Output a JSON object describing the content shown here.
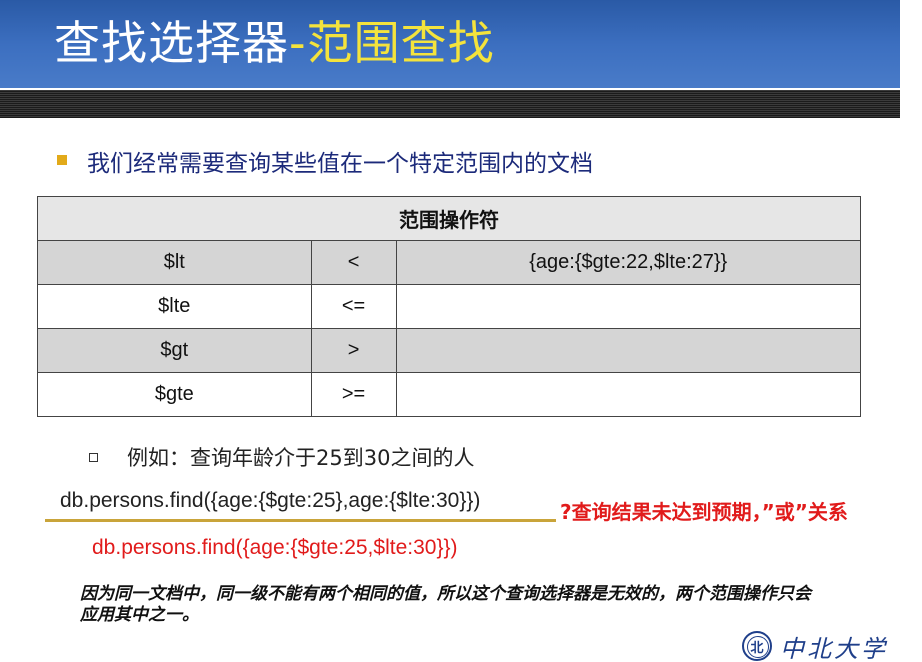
{
  "title": {
    "main": "查找选择器",
    "accent": "-范围查找"
  },
  "bullet_text": "我们经常需要查询某些值在一个特定范围内的文档",
  "table": {
    "header": "范围操作符",
    "rows": [
      {
        "op": "$lt",
        "sym": "<",
        "example": "{age:{$gte:22,$lte:27}}"
      },
      {
        "op": "$lte",
        "sym": "<=",
        "example": ""
      },
      {
        "op": "$gt",
        "sym": ">",
        "example": ""
      },
      {
        "op": "$gte",
        "sym": ">=",
        "example": ""
      }
    ]
  },
  "example_text": "例如：查询年龄介于25到30之间的人",
  "code1": "db.persons.find({age:{$gte:25},age:{$lte:30}})",
  "note": "?查询结果未达到预期，”或”关系",
  "code2": "db.persons.find({age:{$gte:25,$lte:30}})",
  "explanation": "因为同一文档中，同一级不能有两个相同的值，所以这个查询选择器是无效的，两个范围操作只会应用其中之一。",
  "logo": {
    "seal_char": "北",
    "text": "中北大学"
  }
}
